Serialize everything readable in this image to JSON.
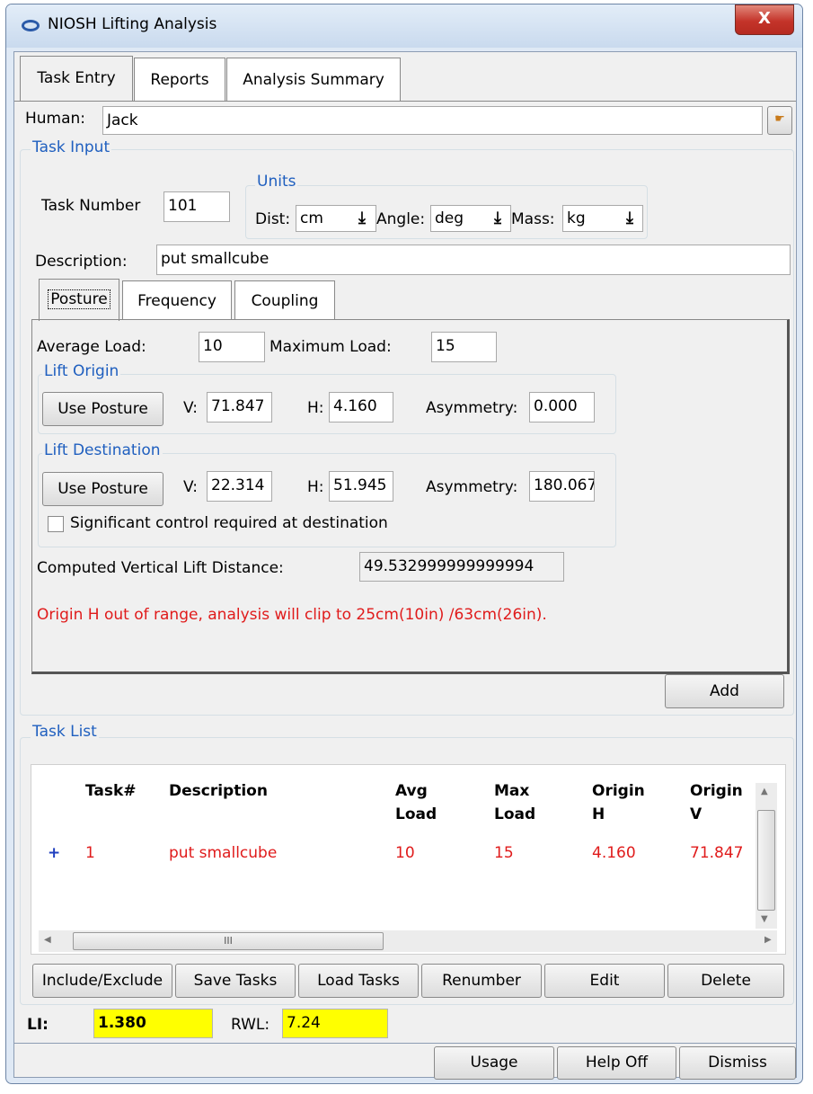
{
  "window": {
    "title": "NIOSH Lifting Analysis",
    "close_label": "X"
  },
  "tabs": [
    {
      "label": "Task Entry"
    },
    {
      "label": "Reports"
    },
    {
      "label": "Analysis Summary"
    }
  ],
  "human": {
    "label": "Human:",
    "value": "Jack"
  },
  "task_input": {
    "group_label": "Task Input",
    "task_number_label": "Task Number",
    "task_number_value": "101",
    "units": {
      "group_label": "Units",
      "dist_label": "Dist:",
      "dist_value": "cm",
      "angle_label": "Angle:",
      "angle_value": "deg",
      "mass_label": "Mass:",
      "mass_value": "kg"
    },
    "description_label": "Description:",
    "description_value": "put smallcube"
  },
  "subtabs": [
    {
      "label": "Posture"
    },
    {
      "label": "Frequency"
    },
    {
      "label": "Coupling"
    }
  ],
  "posture": {
    "average_load_label": "Average Load:",
    "average_load_value": "10",
    "maximum_load_label": "Maximum Load:",
    "maximum_load_value": "15",
    "lift_origin": {
      "group_label": "Lift Origin",
      "use_posture_label": "Use Posture",
      "v_label": "V:",
      "v_value": "71.847",
      "h_label": "H:",
      "h_value": "4.160",
      "asym_label": "Asymmetry:",
      "asym_value": "0.000"
    },
    "lift_destination": {
      "group_label": "Lift Destination",
      "use_posture_label": "Use Posture",
      "v_label": "V:",
      "v_value": "22.314",
      "h_label": "H:",
      "h_value": "51.945",
      "asym_label": "Asymmetry:",
      "asym_value": "180.067",
      "control_label": "Significant control required at destination",
      "control_checked": false
    },
    "computed_label": "Computed Vertical Lift Distance:",
    "computed_value": "49.532999999999994",
    "warning": "Origin H out of range, analysis will clip to 25cm(10in) /63cm(26in)."
  },
  "add_label": "Add",
  "task_list": {
    "group_label": "Task List",
    "columns": [
      {
        "line1": "Task#",
        "line2": ""
      },
      {
        "line1": "Description",
        "line2": ""
      },
      {
        "line1": "Avg",
        "line2": "Load"
      },
      {
        "line1": "Max",
        "line2": "Load"
      },
      {
        "line1": "Origin",
        "line2": "H"
      },
      {
        "line1": "Origin",
        "line2": "V"
      }
    ],
    "rows": [
      {
        "expand": "+",
        "task": "1",
        "description": "put smallcube",
        "avg_load": "10",
        "max_load": "15",
        "origin_h": "4.160",
        "origin_v": "71.847"
      }
    ],
    "scroll_thumb_glyph": "III",
    "buttons": {
      "include": "Include/Exclude",
      "save": "Save Tasks",
      "load": "Load Tasks",
      "renumber": "Renumber",
      "edit": "Edit",
      "delete": "Delete"
    }
  },
  "results": {
    "li_label": "LI:",
    "li_value": "1.380",
    "rwl_label": "RWL:",
    "rwl_value": "7.24",
    "highlight_color": "#ffff00"
  },
  "footer": {
    "usage": "Usage",
    "help": "Help Off",
    "dismiss": "Dismiss"
  }
}
